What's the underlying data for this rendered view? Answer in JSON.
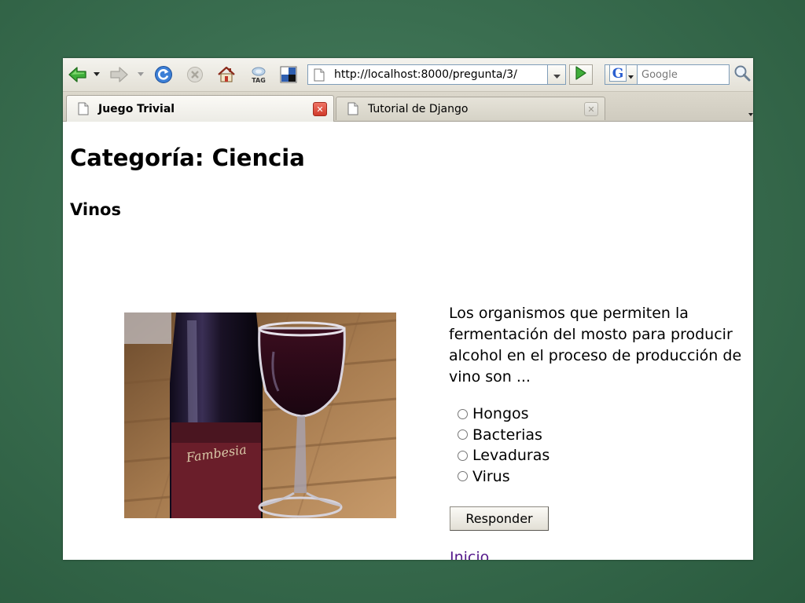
{
  "browser": {
    "url": "http://localhost:8000/pregunta/3/",
    "search_placeholder": "Google",
    "icons": {
      "back": "back-arrow-icon",
      "forward": "forward-arrow-icon",
      "reload": "reload-icon",
      "stop": "stop-icon",
      "home": "home-icon",
      "tag": "tag-icon",
      "extension": "puzzle-squares-icon",
      "go": "go-play-icon",
      "search_engine": "google-g-icon",
      "search": "magnifier-icon"
    },
    "tag_label": "TAG",
    "search_engine_letter": "G",
    "tabs": [
      {
        "label": "Juego Trivial",
        "active": true
      },
      {
        "label": "Tutorial de Django",
        "active": false
      }
    ]
  },
  "page": {
    "heading": "Categoría: Ciencia",
    "subheading": "Vinos",
    "question": "Los organismos que permiten la fermentación del mosto para producir alcohol en el proceso de producción de vino son ...",
    "options": [
      "Hongos",
      "Bacterias",
      "Levaduras",
      "Virus"
    ],
    "submit_label": "Responder",
    "home_link": "Inicio",
    "photo_label_text": "Fambesia"
  },
  "colors": {
    "desktop_green": "#3a6e50",
    "link_visited": "#551a8b",
    "close_red": "#d03a2a"
  }
}
